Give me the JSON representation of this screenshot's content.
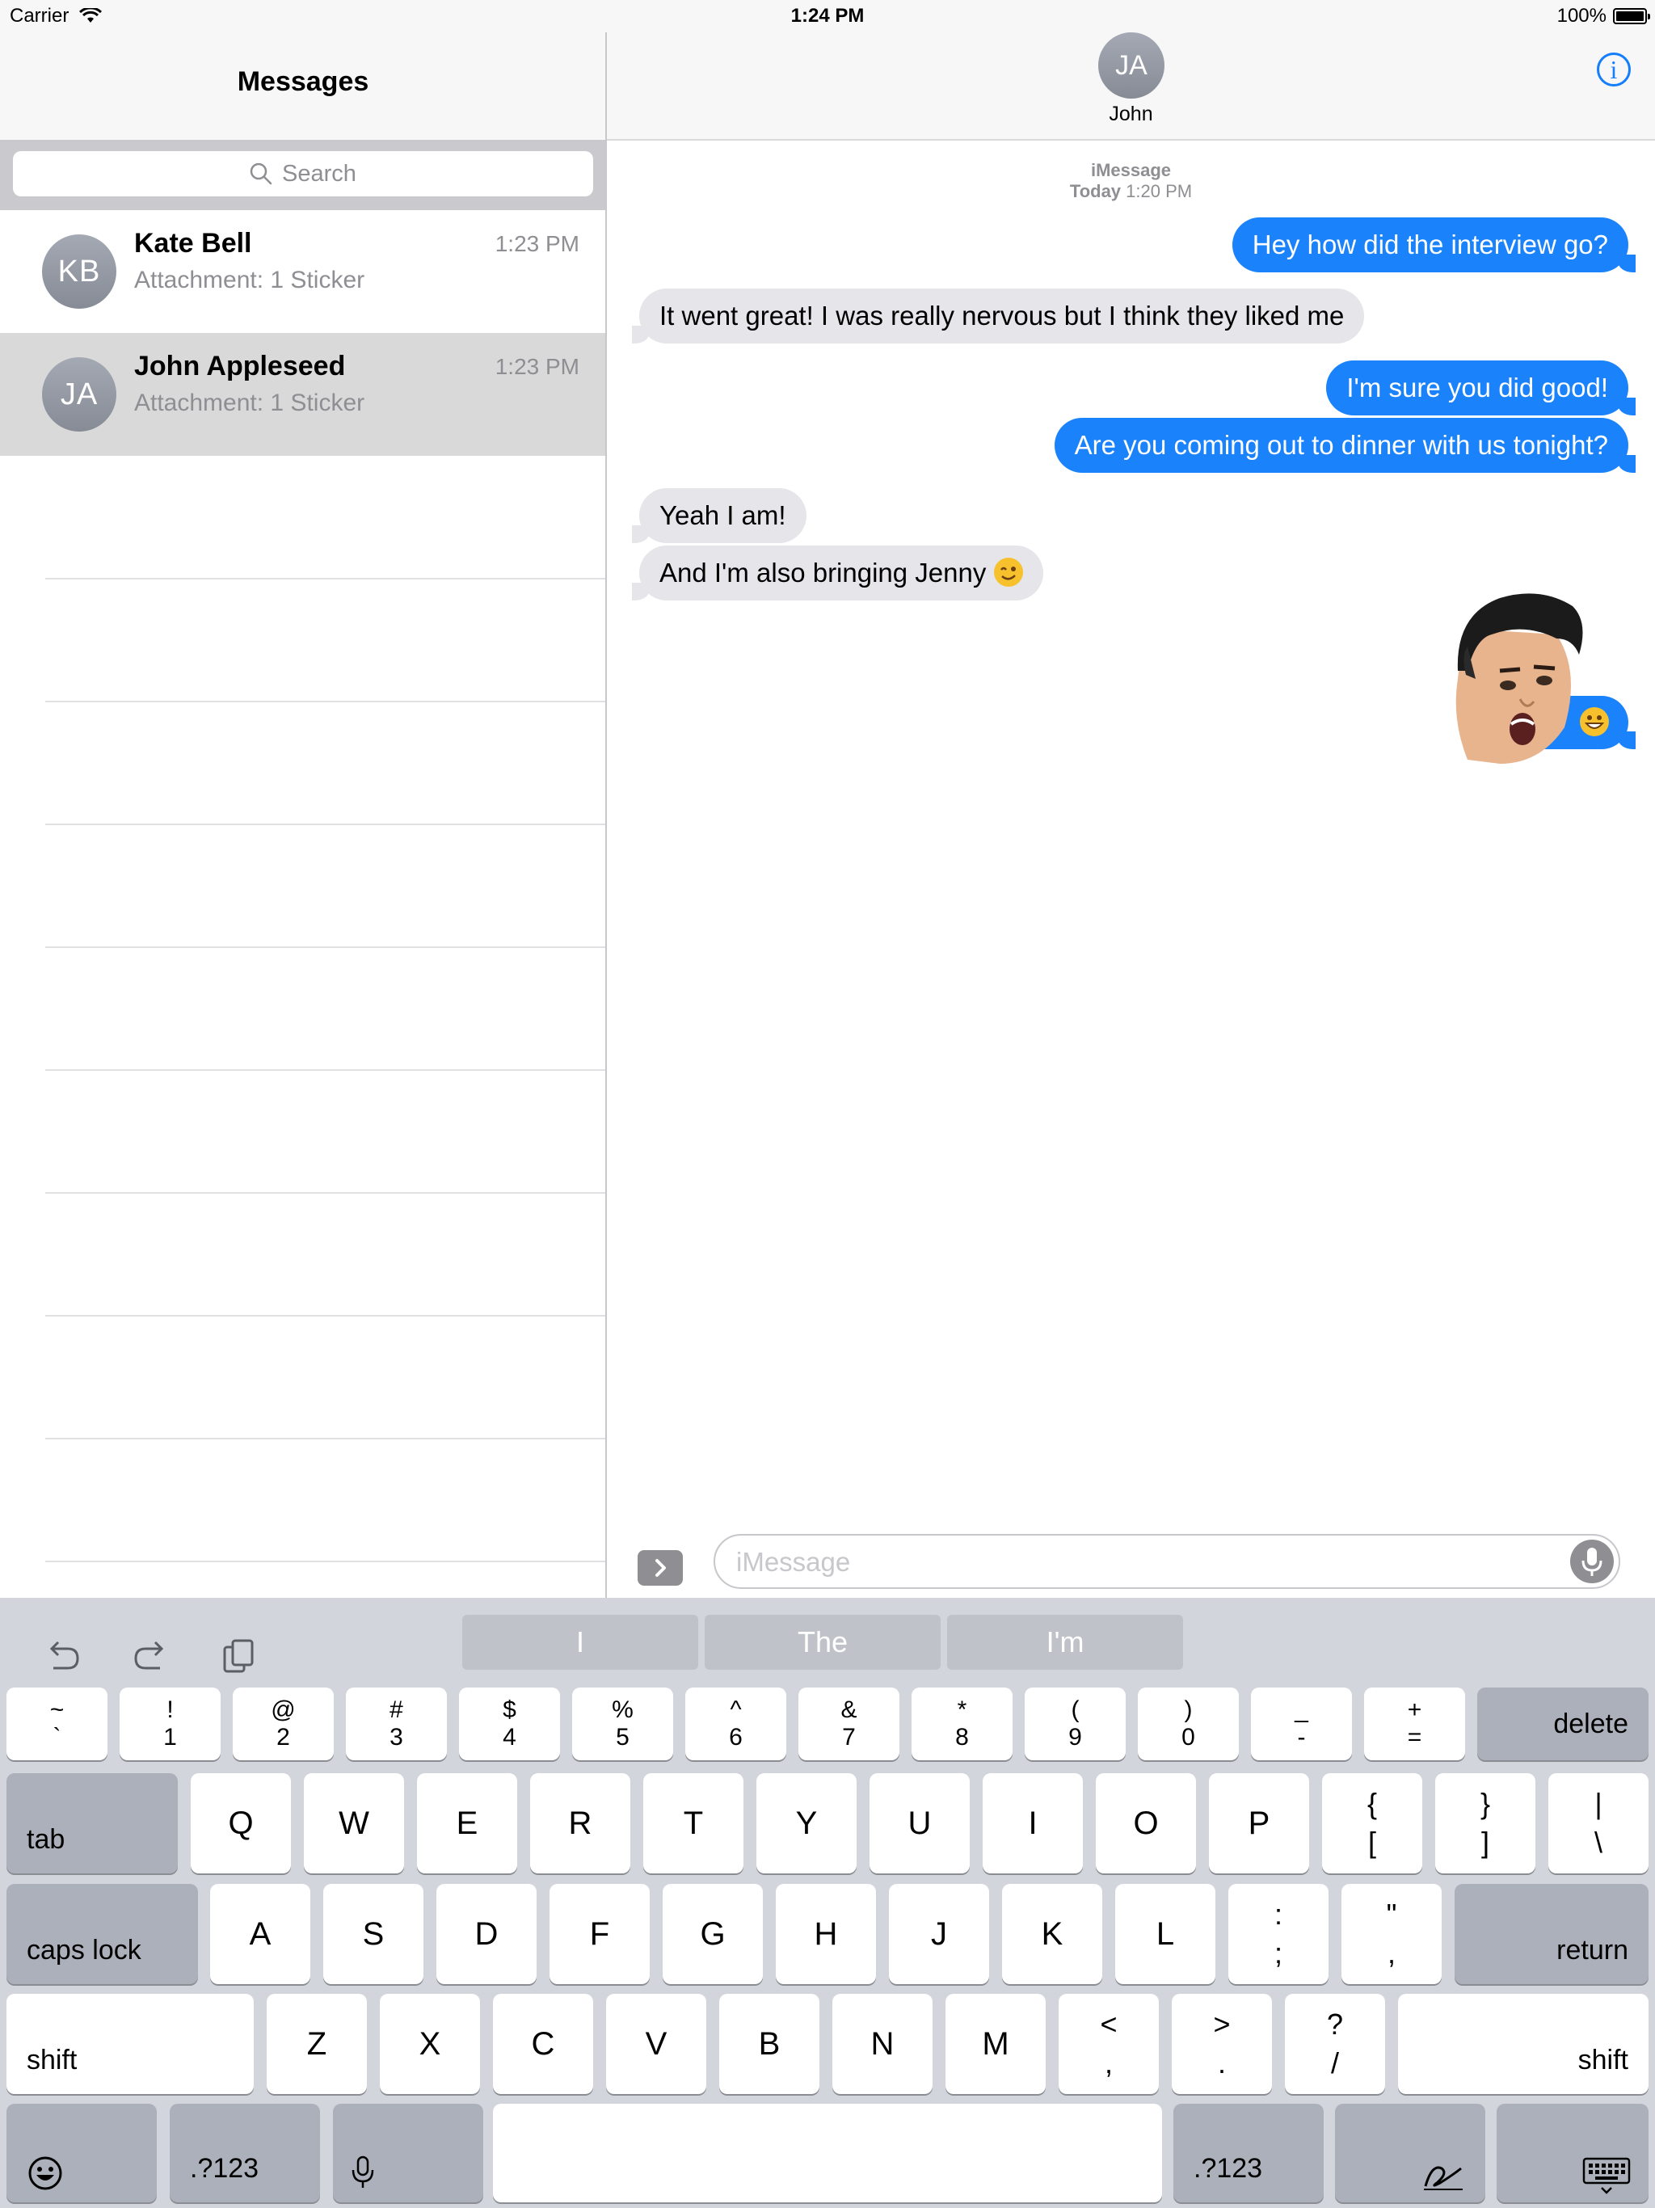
{
  "status_bar": {
    "carrier": "Carrier",
    "time": "1:24 PM",
    "battery": "100%"
  },
  "left_pane": {
    "title": "Messages",
    "search_placeholder": "Search",
    "conversations": [
      {
        "initials": "KB",
        "name": "Kate Bell",
        "preview": "Attachment: 1 Sticker",
        "time": "1:23 PM",
        "selected": false
      },
      {
        "initials": "JA",
        "name": "John Appleseed",
        "preview": "Attachment: 1 Sticker",
        "time": "1:23 PM",
        "selected": true
      }
    ]
  },
  "chat": {
    "contact_initials": "JA",
    "contact_name": "John",
    "info_icon": "info-icon",
    "service": "iMessage",
    "date_prefix": "Today",
    "date_time": "1:20 PM",
    "messages": [
      {
        "direction": "out",
        "text": "Hey how did the interview go?"
      },
      {
        "direction": "in",
        "text": "It went great! I was really nervous but I think they liked me"
      },
      {
        "direction": "out",
        "text": "I'm sure you did good!"
      },
      {
        "direction": "out",
        "text": "Are you coming out to dinner with us tonight?"
      },
      {
        "direction": "in",
        "text": "Yeah I am!"
      },
      {
        "direction": "in",
        "text": "And I'm also bringing Jenny",
        "emoji": "wink-emoji"
      },
      {
        "direction": "out",
        "type": "sticker",
        "emoji": "grin-emoji"
      }
    ],
    "input_placeholder": "iMessage"
  },
  "keyboard": {
    "suggestions": [
      "I",
      "The",
      "I'm"
    ],
    "row1": [
      {
        "top": "~",
        "bottom": "`"
      },
      {
        "top": "!",
        "bottom": "1"
      },
      {
        "top": "@",
        "bottom": "2"
      },
      {
        "top": "#",
        "bottom": "3"
      },
      {
        "top": "$",
        "bottom": "4"
      },
      {
        "top": "%",
        "bottom": "5"
      },
      {
        "top": "^",
        "bottom": "6"
      },
      {
        "top": "&",
        "bottom": "7"
      },
      {
        "top": "*",
        "bottom": "8"
      },
      {
        "top": "(",
        "bottom": "9"
      },
      {
        "top": ")",
        "bottom": "0"
      },
      {
        "top": "_",
        "bottom": "-"
      },
      {
        "top": "+",
        "bottom": "="
      }
    ],
    "row2": [
      "Q",
      "W",
      "E",
      "R",
      "T",
      "Y",
      "U",
      "I",
      "O",
      "P"
    ],
    "row2_extra": [
      {
        "top": "{",
        "bottom": "["
      },
      {
        "top": "}",
        "bottom": "]"
      },
      {
        "top": "|",
        "bottom": "\\"
      }
    ],
    "row3": [
      "A",
      "S",
      "D",
      "F",
      "G",
      "H",
      "J",
      "K",
      "L"
    ],
    "row3_extra": [
      {
        "top": ":",
        "bottom": ";"
      },
      {
        "top": "\"",
        "bottom": ","
      }
    ],
    "row4": [
      "Z",
      "X",
      "C",
      "V",
      "B",
      "N",
      "M"
    ],
    "row4_extra": [
      {
        "top": "<",
        "bottom": ","
      },
      {
        "top": ">",
        "bottom": "."
      },
      {
        "top": "?",
        "bottom": "/"
      }
    ],
    "delete": "delete",
    "tab": "tab",
    "caps_lock": "caps lock",
    "return": "return",
    "shift": "shift",
    "numbers": ".?123"
  }
}
